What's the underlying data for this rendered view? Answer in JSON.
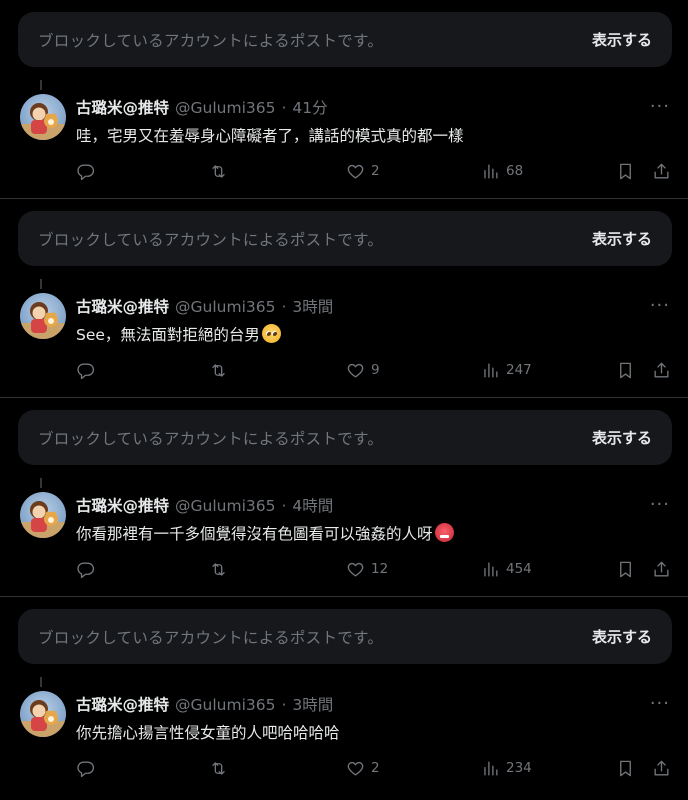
{
  "notice_text": "ブロックしているアカウントによるポストです。",
  "show_label": "表示する",
  "posts": [
    {
      "name": "古璐米@推特",
      "handle": "@Gulumi365",
      "sep": "·",
      "time": "41分",
      "text": "哇，宅男又在羞辱身心障礙者了，講話的模式真的都一樣",
      "emoji": "",
      "likes": "2",
      "views": "68"
    },
    {
      "name": "古璐米@推特",
      "handle": "@Gulumi365",
      "sep": "·",
      "time": "3時間",
      "text": "See，無法面對拒絕的台男",
      "emoji": "pleading-face",
      "likes": "9",
      "views": "247"
    },
    {
      "name": "古璐米@推特",
      "handle": "@Gulumi365",
      "sep": "·",
      "time": "4時間",
      "text": "你看那裡有一千多個覺得沒有色圖看可以強姦的人呀",
      "emoji": "angry-face",
      "likes": "12",
      "views": "454"
    },
    {
      "name": "古璐米@推特",
      "handle": "@Gulumi365",
      "sep": "·",
      "time": "3時間",
      "text": "你先擔心揚言性侵女童的人吧哈哈哈哈",
      "emoji": "",
      "likes": "2",
      "views": "234"
    }
  ],
  "icons": {
    "reply": "reply-icon",
    "retweet": "retweet-icon",
    "like": "heart-icon",
    "views": "views-icon",
    "bookmark": "bookmark-icon",
    "share": "share-icon",
    "more": "more-icon"
  }
}
